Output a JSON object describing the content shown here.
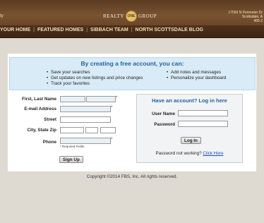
{
  "header": {
    "left_fragment": "ty",
    "logo": {
      "left_word": "REALTY",
      "seal_text": "ONE",
      "right_word": "GROUP"
    },
    "address_lines": [
      "17550 N Perimeter Dr",
      "Scottsdale, A",
      "480-2"
    ]
  },
  "nav": {
    "items": [
      "YOUR HOME",
      "FEATURED HOMES",
      "SIBBACH TEAM",
      "NORTH SCOTTSDALE BLOG"
    ],
    "separator": "|"
  },
  "promo": {
    "title": "By creating a free account, you can:",
    "left_items": [
      "Save your searches",
      "Get updates on new listings and price changes",
      "Track your favorites"
    ],
    "right_items": [
      "Add notes and messages",
      "Personalize your dashboard"
    ]
  },
  "form": {
    "labels": {
      "name": "First, Last Name",
      "email": "E-mail Address",
      "street": "Street",
      "city_state_zip": "City, State Zip",
      "phone": "Phone"
    },
    "required_mark": "*",
    "required_hint": "* Required Fields",
    "values": {
      "first": "",
      "last": "",
      "email": "",
      "street": "",
      "city": "",
      "state": "",
      "zip": "",
      "phone": ""
    },
    "signup_label": "Sign Up"
  },
  "login": {
    "title": "Have an account? Log in here",
    "username_label": "User Name",
    "password_label": "Password",
    "button_label": "Log In",
    "pw_note": "Password not working?",
    "pw_link": "Click Here"
  },
  "footer": {
    "copyright": "Copyright ©2014 FBS, Inc. All rights reserved."
  },
  "colors": {
    "accent_blue": "#2163a6",
    "header_brown": "#5a3a22",
    "page_bg": "#ded9d1"
  }
}
